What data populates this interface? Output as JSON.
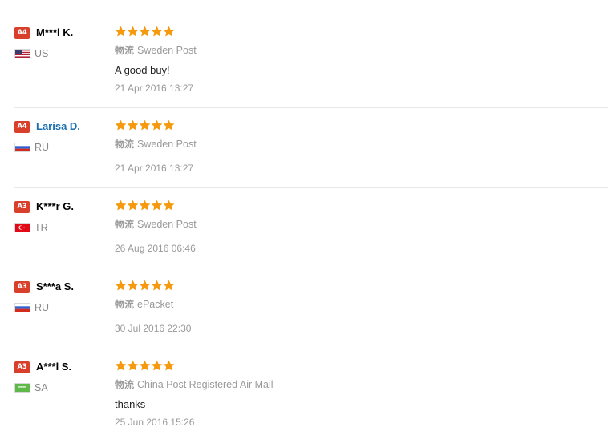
{
  "feedback": {
    "logistics_label": "物流",
    "reviews": [
      {
        "level": "A4",
        "name": "M***l K.",
        "country": "US",
        "rating": 5,
        "shipping": "Sweden Post",
        "comment": "A good buy!",
        "date": "21 Apr 2016 13:27"
      },
      {
        "level": "A4",
        "name": "Larisa D.",
        "country": "RU",
        "rating": 5,
        "shipping": "Sweden Post",
        "comment": "",
        "date": "21 Apr 2016 13:27"
      },
      {
        "level": "A3",
        "name": "K***r G.",
        "country": "TR",
        "rating": 5,
        "shipping": "Sweden Post",
        "comment": "",
        "date": "26 Aug 2016 06:46"
      },
      {
        "level": "A3",
        "name": "S***a S.",
        "country": "RU",
        "rating": 5,
        "shipping": "ePacket",
        "comment": "",
        "date": "30 Jul 2016 22:30"
      },
      {
        "level": "A3",
        "name": "A***l S.",
        "country": "SA",
        "rating": 5,
        "shipping": "China Post Registered Air Mail",
        "comment": "thanks",
        "date": "25 Jun 2016 15:26"
      }
    ]
  },
  "colors": {
    "badge": "#d9402b",
    "star": "#f59a0f",
    "link_name": "#1a6fb0",
    "divider": "#e8e8e8"
  },
  "icons": {
    "star": "star-icon",
    "flags": [
      "us-flag-icon",
      "ru-flag-icon",
      "tr-flag-icon",
      "ru-flag-icon",
      "sa-flag-icon"
    ]
  }
}
